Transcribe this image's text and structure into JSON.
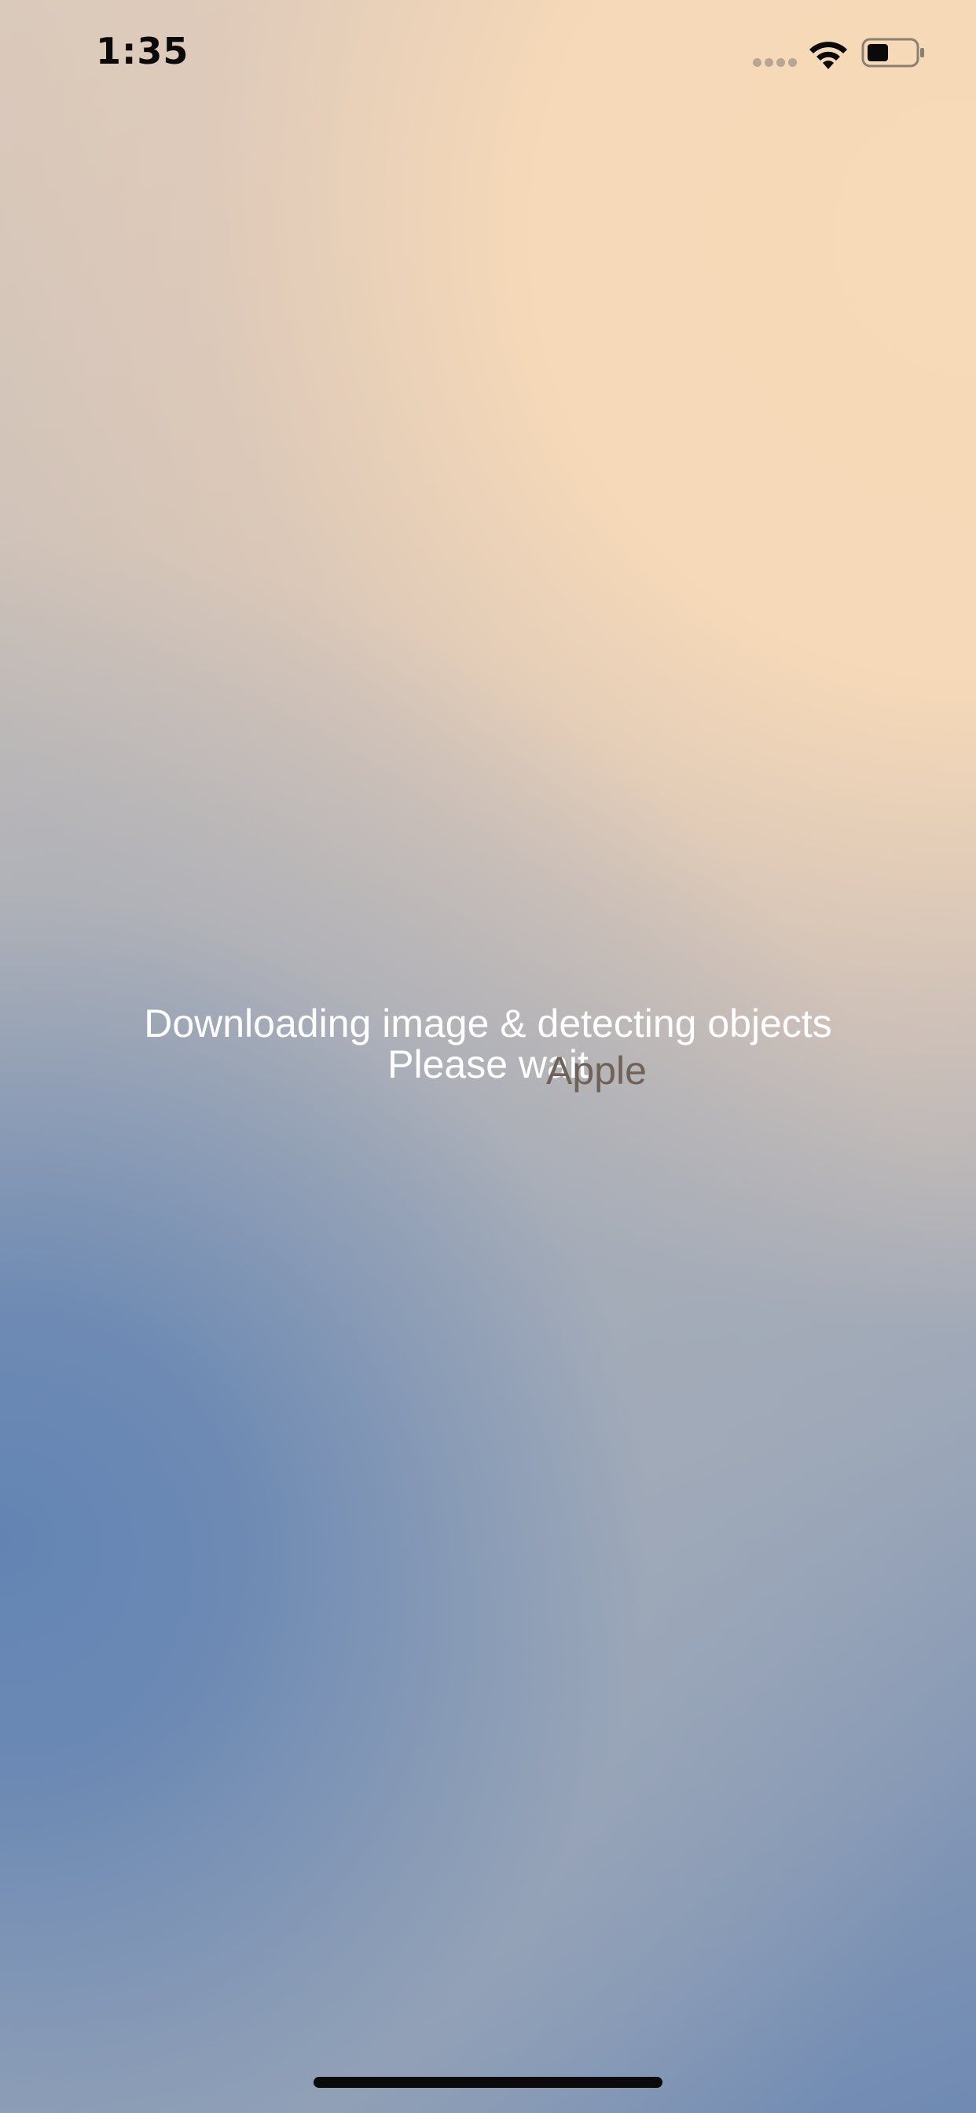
{
  "status_bar": {
    "time": "1:35",
    "signal_icon": "cellular-dots-icon",
    "wifi_icon": "wifi-icon",
    "battery_icon": "battery-icon",
    "battery_level": 0.45
  },
  "loading": {
    "line1": "Downloading image & detecting objects",
    "line2": "Please wait",
    "overlay_label": "Apple"
  },
  "colors": {
    "text_primary": "#ffffff",
    "overlay_text": "#6e6259",
    "gradient_warm": "#f7dab8",
    "gradient_cool": "#6384b3"
  }
}
